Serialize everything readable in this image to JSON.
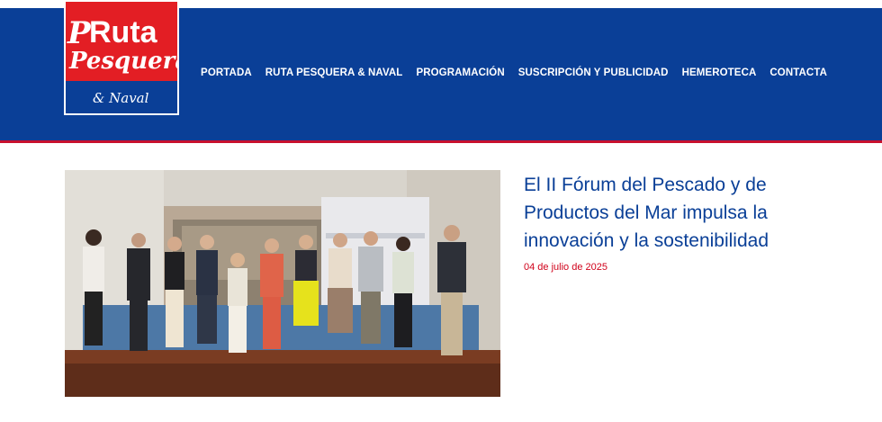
{
  "brand": {
    "name_line1": "Ruta",
    "name_line2": "Pesquera",
    "name_line3": "& Naval",
    "colors": {
      "red": "#e31e24",
      "blue": "#0a3f97"
    }
  },
  "nav": {
    "items": [
      {
        "label": "PORTADA"
      },
      {
        "label": "RUTA PESQUERA & NAVAL"
      },
      {
        "label": "PROGRAMACIÓN"
      },
      {
        "label": "SUSCRIPCIÓN Y PUBLICIDAD"
      },
      {
        "label": "HEMEROTECA"
      },
      {
        "label": "CONTACTA"
      }
    ]
  },
  "article": {
    "title": "El II Fórum del Pescado y de Productos del Mar impulsa la innovación y la sostenibilidad",
    "date": "04 de julio de 2025"
  }
}
